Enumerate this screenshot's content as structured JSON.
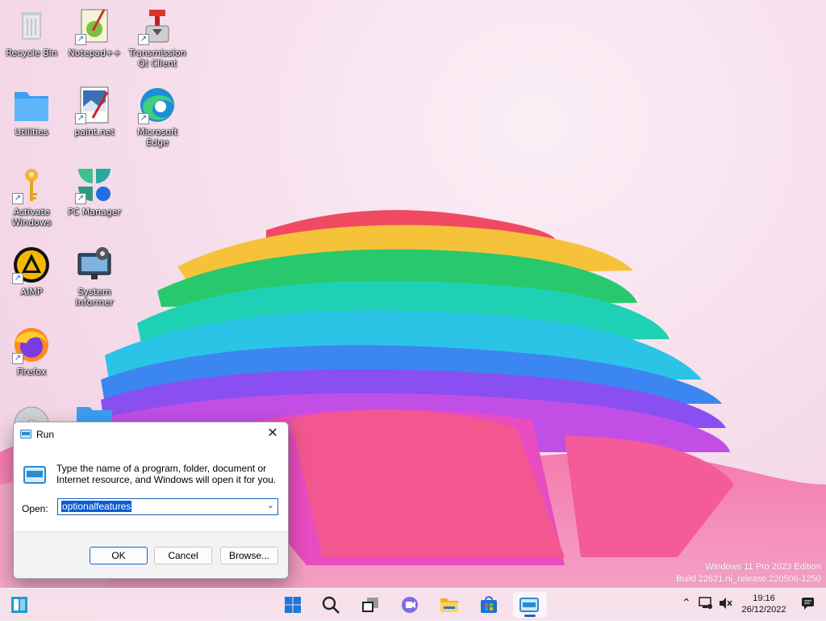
{
  "desktop": {
    "icons": [
      {
        "label": "Recycle Bin",
        "icon": "recycle-bin-icon"
      },
      {
        "label": "Notepad++",
        "icon": "notepadpp-icon"
      },
      {
        "label": "Transmission Qt Client",
        "icon": "transmission-icon"
      },
      {
        "label": "Utilities",
        "icon": "folder-icon"
      },
      {
        "label": "paint.net",
        "icon": "paintnet-icon"
      },
      {
        "label": "Microsoft Edge",
        "icon": "edge-icon"
      },
      {
        "label": "Activate Windows",
        "icon": "key-icon"
      },
      {
        "label": "PC Manager",
        "icon": "pc-manager-icon"
      },
      {
        "label": "AIMP",
        "icon": "aimp-icon"
      },
      {
        "label": "System Informer",
        "icon": "system-informer-icon"
      },
      {
        "label": "Firefox",
        "icon": "firefox-icon"
      }
    ]
  },
  "run_dialog": {
    "title": "Run",
    "close_glyph": "✕",
    "description": "Type the name of a program, folder, document or Internet resource, and Windows will open it for you.",
    "open_label": "Open:",
    "open_value": "optionalfeatures",
    "ok_label": "OK",
    "cancel_label": "Cancel",
    "browse_label": "Browse..."
  },
  "watermark": {
    "line1": "Windows 11 Pro 2023 Edition",
    "line2": "Build 22621.ni_release.220506-1250"
  },
  "taskbar": {
    "items": [
      "widgets-icon",
      "start-icon",
      "search-icon",
      "task-view-icon",
      "teams-chat-icon",
      "file-explorer-icon",
      "store-icon",
      "run-app-icon"
    ],
    "active": "run-app-icon",
    "tray": [
      "chevron-up-icon",
      "network-icon",
      "volume-muted-icon",
      "notification-icon"
    ]
  },
  "clock": {
    "time": "19:16",
    "date": "26/12/2022"
  },
  "colors": {
    "accent": "#1b63c6",
    "selection": "#0a5bd3"
  }
}
